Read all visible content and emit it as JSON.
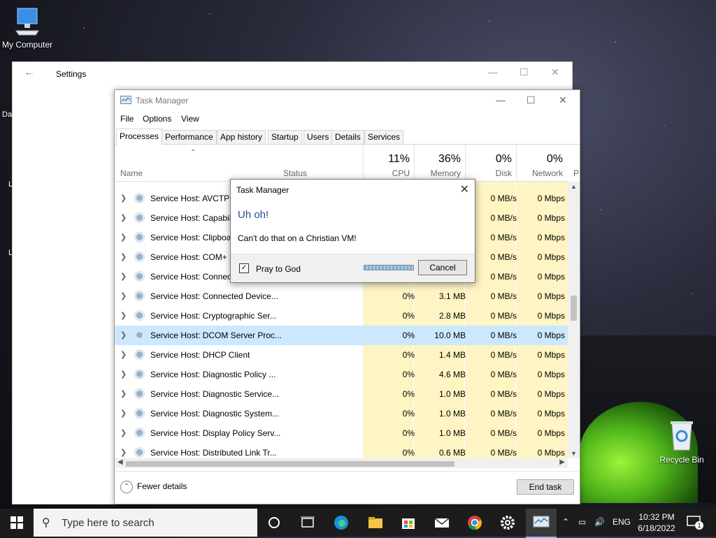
{
  "desktop": {
    "icons": [
      {
        "label": "My Computer"
      },
      {
        "label": "Recycle Bin"
      }
    ],
    "partial_labels": [
      "Da",
      "L",
      "L"
    ]
  },
  "settings_window": {
    "title": "Settings"
  },
  "task_manager": {
    "title": "Task Manager",
    "menu": [
      "File",
      "Options",
      "View"
    ],
    "tabs": [
      "Processes",
      "Performance",
      "App history",
      "Startup",
      "Users",
      "Details",
      "Services"
    ],
    "active_tab": "Processes",
    "columns": {
      "name": "Name",
      "status": "Status",
      "cpu": {
        "pct": "11%",
        "label": "CPU"
      },
      "memory": {
        "pct": "36%",
        "label": "Memory"
      },
      "disk": {
        "pct": "0%",
        "label": "Disk"
      },
      "network": {
        "pct": "0%",
        "label": "Network"
      },
      "extra": "P"
    },
    "rows": [
      {
        "name": "Service Host: AVCTP s",
        "cpu": "",
        "mem": "",
        "disk": "0 MB/s",
        "net": "0 Mbps"
      },
      {
        "name": "Service Host: Capabili",
        "cpu": "",
        "mem": "",
        "disk": "0 MB/s",
        "net": "0 Mbps"
      },
      {
        "name": "Service Host: Clipboa",
        "cpu": "",
        "mem": "",
        "disk": "0 MB/s",
        "net": "0 Mbps"
      },
      {
        "name": "Service Host: COM+ E",
        "cpu": "",
        "mem": "",
        "disk": "0 MB/s",
        "net": "0 Mbps"
      },
      {
        "name": "Service Host: Connect",
        "cpu": "",
        "mem": "",
        "disk": "0 MB/s",
        "net": "0 Mbps"
      },
      {
        "name": "Service Host: Connected Device...",
        "cpu": "0%",
        "mem": "3.1 MB",
        "disk": "0 MB/s",
        "net": "0 Mbps"
      },
      {
        "name": "Service Host: Cryptographic Ser...",
        "cpu": "0%",
        "mem": "2.8 MB",
        "disk": "0 MB/s",
        "net": "0 Mbps"
      },
      {
        "name": "Service Host: DCOM Server Proc...",
        "cpu": "0%",
        "mem": "10.0 MB",
        "disk": "0 MB/s",
        "net": "0 Mbps"
      },
      {
        "name": "Service Host: DHCP Client",
        "cpu": "0%",
        "mem": "1.4 MB",
        "disk": "0 MB/s",
        "net": "0 Mbps"
      },
      {
        "name": "Service Host: Diagnostic Policy ...",
        "cpu": "0%",
        "mem": "4.6 MB",
        "disk": "0 MB/s",
        "net": "0 Mbps"
      },
      {
        "name": "Service Host: Diagnostic Service...",
        "cpu": "0%",
        "mem": "1.0 MB",
        "disk": "0 MB/s",
        "net": "0 Mbps"
      },
      {
        "name": "Service Host: Diagnostic System...",
        "cpu": "0%",
        "mem": "1.0 MB",
        "disk": "0 MB/s",
        "net": "0 Mbps"
      },
      {
        "name": "Service Host: Display Policy Serv...",
        "cpu": "0%",
        "mem": "1.0 MB",
        "disk": "0 MB/s",
        "net": "0 Mbps"
      },
      {
        "name": "Service Host: Distributed Link Tr...",
        "cpu": "0%",
        "mem": "0.6 MB",
        "disk": "0 MB/s",
        "net": "0 Mbps"
      }
    ],
    "selected_row": "Service Host: DCOM Server Proc...",
    "fewer_details": "Fewer details",
    "end_task": "End task"
  },
  "dialog": {
    "title": "Task Manager",
    "main_instruction": "Uh oh!",
    "message": "Can't do that on a Christian VM!",
    "checkbox_label": "Pray to God",
    "checkbox_checked": true,
    "cancel": "Cancel"
  },
  "taskbar": {
    "search_placeholder": "Type here to search",
    "language": "ENG",
    "time": "10:32 PM",
    "date": "6/18/2022",
    "notification_count": "1"
  },
  "colors": {
    "accent": "#0078d7",
    "heat_yellow": "#fff4c4",
    "selected_row": "#cce8ff",
    "dialog_heading": "#1f4e9c"
  }
}
